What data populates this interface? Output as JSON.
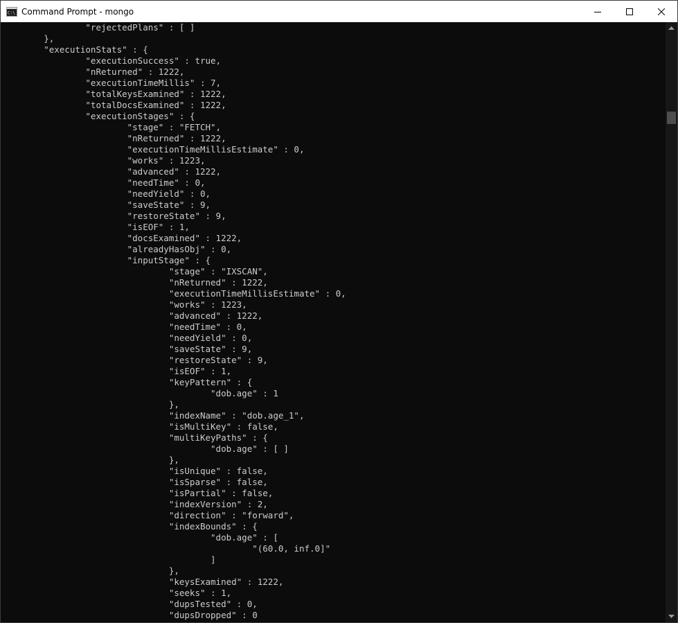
{
  "window": {
    "title": "Command Prompt - mongo",
    "icon": "cmd-icon"
  },
  "caption_buttons": {
    "minimize_icon": "minimize-icon",
    "maximize_icon": "maximize-icon",
    "close_icon": "close-icon"
  },
  "console": {
    "lines": [
      "                \"rejectedPlans\" : [ ]",
      "        },",
      "        \"executionStats\" : {",
      "                \"executionSuccess\" : true,",
      "                \"nReturned\" : 1222,",
      "                \"executionTimeMillis\" : 7,",
      "                \"totalKeysExamined\" : 1222,",
      "                \"totalDocsExamined\" : 1222,",
      "                \"executionStages\" : {",
      "                        \"stage\" : \"FETCH\",",
      "                        \"nReturned\" : 1222,",
      "                        \"executionTimeMillisEstimate\" : 0,",
      "                        \"works\" : 1223,",
      "                        \"advanced\" : 1222,",
      "                        \"needTime\" : 0,",
      "                        \"needYield\" : 0,",
      "                        \"saveState\" : 9,",
      "                        \"restoreState\" : 9,",
      "                        \"isEOF\" : 1,",
      "                        \"docsExamined\" : 1222,",
      "                        \"alreadyHasObj\" : 0,",
      "                        \"inputStage\" : {",
      "                                \"stage\" : \"IXSCAN\",",
      "                                \"nReturned\" : 1222,",
      "                                \"executionTimeMillisEstimate\" : 0,",
      "                                \"works\" : 1223,",
      "                                \"advanced\" : 1222,",
      "                                \"needTime\" : 0,",
      "                                \"needYield\" : 0,",
      "                                \"saveState\" : 9,",
      "                                \"restoreState\" : 9,",
      "                                \"isEOF\" : 1,",
      "                                \"keyPattern\" : {",
      "                                        \"dob.age\" : 1",
      "                                },",
      "                                \"indexName\" : \"dob.age_1\",",
      "                                \"isMultiKey\" : false,",
      "                                \"multiKeyPaths\" : {",
      "                                        \"dob.age\" : [ ]",
      "                                },",
      "                                \"isUnique\" : false,",
      "                                \"isSparse\" : false,",
      "                                \"isPartial\" : false,",
      "                                \"indexVersion\" : 2,",
      "                                \"direction\" : \"forward\",",
      "                                \"indexBounds\" : {",
      "                                        \"dob.age\" : [",
      "                                                \"(60.0, inf.0]\"",
      "                                        ]",
      "                                },",
      "                                \"keysExamined\" : 1222,",
      "                                \"seeks\" : 1,",
      "                                \"dupsTested\" : 0,",
      "                                \"dupsDropped\" : 0"
    ]
  },
  "scrollbar": {
    "up_icon": "scroll-up-arrow-icon",
    "down_icon": "scroll-down-arrow-icon"
  },
  "colors": {
    "console_background": "#0c0c0c",
    "console_text": "#cccccc",
    "titlebar": "#ffffff",
    "scroll_thumb": "#4d4d4d"
  }
}
